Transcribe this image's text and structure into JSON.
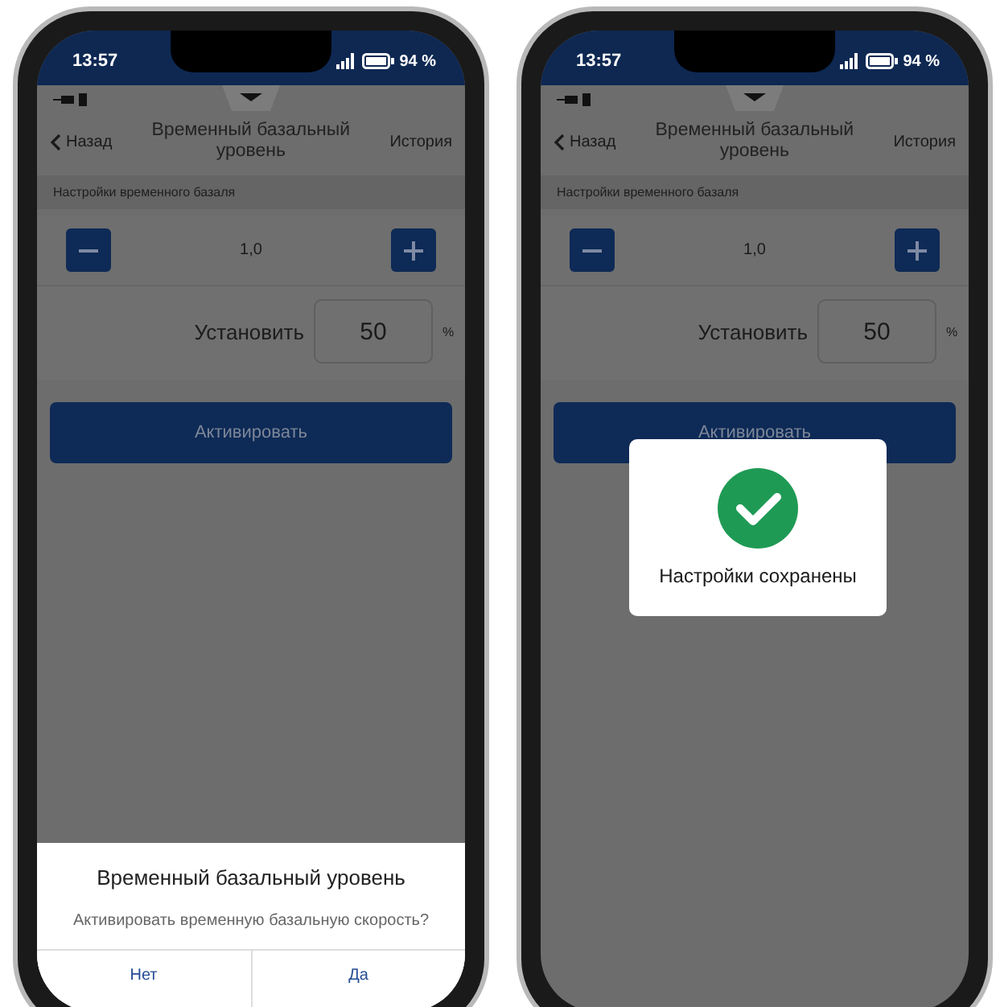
{
  "phones": [
    {
      "status_bar": {
        "time": "13:57",
        "battery": "94 %"
      },
      "nav": {
        "back": "Назад",
        "title": "Временный базальный уровень",
        "action": "История"
      },
      "section_label": "Настройки временного базаля",
      "stepper": {
        "value": "1,0"
      },
      "set_label": "Установить",
      "set_value": "50",
      "unit": "%",
      "activate_button": "Активировать",
      "overlay": {
        "kind": "dialog",
        "title": "Временный базальный уровень",
        "message": "Активировать временную базальную скорость?",
        "buttons": [
          "Нет",
          "Да"
        ]
      }
    },
    {
      "status_bar": {
        "time": "13:57",
        "battery": "94 %"
      },
      "nav": {
        "back": "Назад",
        "title": "Временный базальный уровень",
        "action": "История"
      },
      "section_label": "Настройки временного базаля",
      "stepper": {
        "value": "1,0"
      },
      "set_label": "Установить",
      "set_value": "50",
      "unit": "%",
      "activate_button": "Активировать",
      "overlay": {
        "kind": "toast",
        "message": "Настройки сохранены"
      }
    }
  ]
}
